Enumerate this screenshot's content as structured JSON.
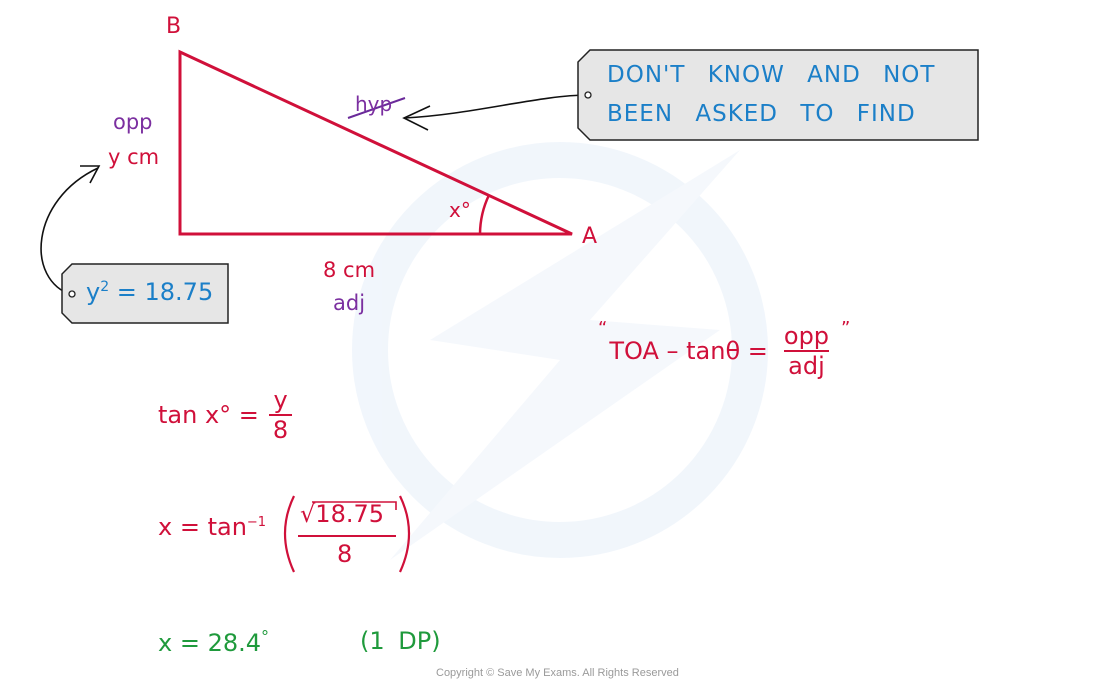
{
  "colors": {
    "triangle": "#d0103a",
    "labels_ratio": "#7b2fa0",
    "tag_text": "#1b7fc8",
    "answer": "#1f9a3c",
    "tag_fill": "#e6e6e6",
    "watermark": "#eef4fb"
  },
  "triangle": {
    "vertex_b": "B",
    "vertex_a": "A",
    "angle_label": "x°",
    "side_opp_ratio": "opp",
    "side_opp_length": "y cm",
    "side_adj_length": "8 cm",
    "side_adj_ratio": "adj",
    "side_hyp_ratio": "hyp",
    "hyp_crossed_out": true
  },
  "tags": {
    "hyp_note": {
      "line1": "DON'T KNOW AND NOT",
      "line2": "BEEN ASKED TO FIND"
    },
    "y_note": {
      "lhs": "y",
      "exp": "2",
      "rhs": "= 18.75"
    }
  },
  "formula": {
    "open_quote": "“",
    "prefix": "TOA – tanθ =",
    "numerator": "opp",
    "denominator": "adj",
    "close_quote": "”"
  },
  "working": {
    "step1": {
      "lhs": "tan x° =",
      "numerator": "y",
      "denominator": "8"
    },
    "step2": {
      "lhs": "x = tan",
      "exp": "−1",
      "sqrt_symbol": "√",
      "numerator": "18.75",
      "denominator": "8"
    },
    "answer": {
      "text": "x = 28.4",
      "degree": "°",
      "note": "(1  DP)"
    }
  },
  "footer": {
    "copyright": "Copyright © Save My Exams. All Rights Reserved"
  }
}
